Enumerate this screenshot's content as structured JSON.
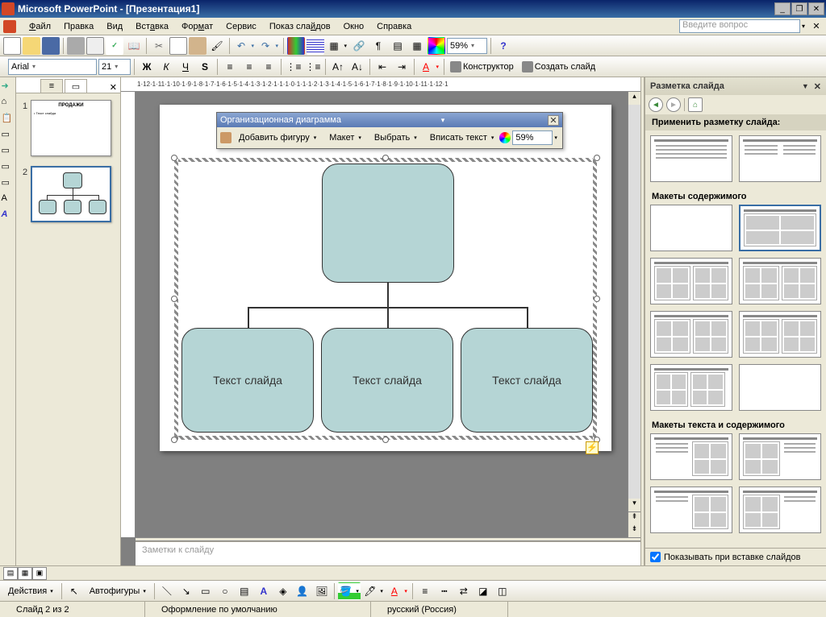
{
  "title": "Microsoft PowerPoint - [Презентация1]",
  "ask_box": "Введите вопрос",
  "menu": {
    "file": "Файл",
    "edit": "Правка",
    "view": "Вид",
    "insert": "Вставка",
    "format": "Формат",
    "tools": "Сервис",
    "slideshow": "Показ слайдов",
    "window": "Окно",
    "help": "Справка"
  },
  "toolbar": {
    "zoom": "59%",
    "designer": "Конструктор",
    "new_slide": "Создать слайд"
  },
  "format_toolbar": {
    "font": "Arial",
    "size": "21"
  },
  "ruler": "1·12·1·11·1·10·1·9·1·8·1·7·1·6·1·5·1·4·1·3·1·2·1·1·1·0·1·1·1·2·1·3·1·4·1·5·1·6·1·7·1·8·1·9·1·10·1·11·1·12·1",
  "slides": {
    "s1": {
      "num": "1",
      "title": "ПРОДАЖИ"
    },
    "s2": {
      "num": "2"
    }
  },
  "orgchart": {
    "title": "Организационная диаграмма",
    "add_shape": "Добавить фигуру",
    "layout": "Макет",
    "select": "Выбрать",
    "fit_text": "Вписать текст",
    "zoom": "59%"
  },
  "diagram": {
    "child1": "Текст слайда",
    "child2": "Текст слайда",
    "child3": "Текст слайда"
  },
  "notes_placeholder": "Заметки к слайду",
  "task_pane": {
    "title": "Разметка слайда",
    "apply_layout": "Применить разметку слайда:",
    "content_layouts": "Макеты содержимого",
    "text_content_layouts": "Макеты текста и содержимого",
    "show_on_insert": "Показывать при вставке слайдов"
  },
  "draw_toolbar": {
    "actions": "Действия",
    "autoshapes": "Автофигуры"
  },
  "status": {
    "slide": "Слайд 2 из 2",
    "design": "Оформление по умолчанию",
    "lang": "русский (Россия)"
  }
}
